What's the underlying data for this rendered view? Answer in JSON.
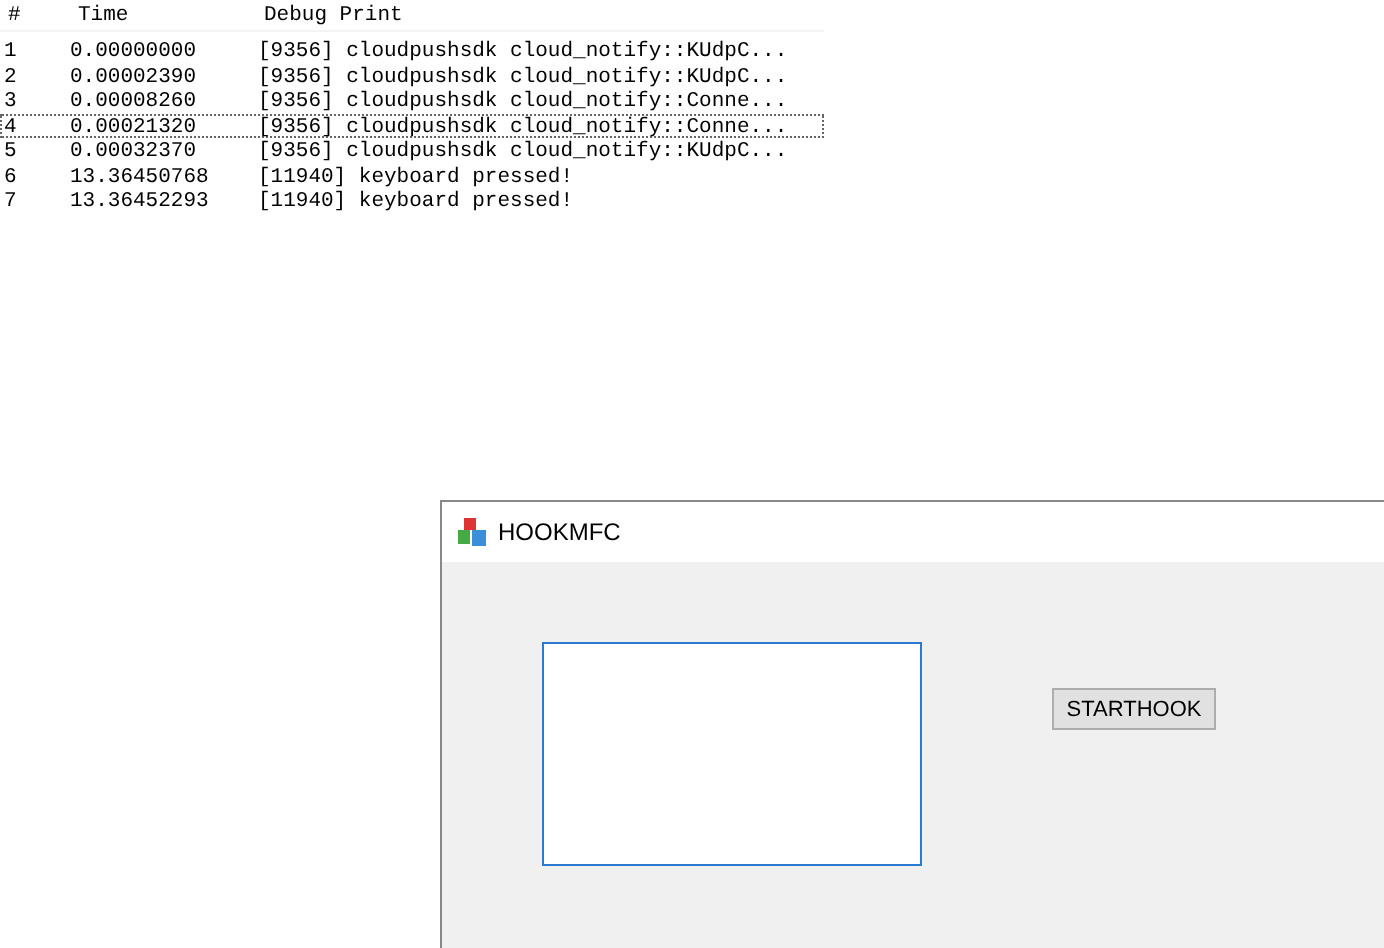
{
  "log": {
    "columns": [
      "#",
      "Time",
      "Debug Print"
    ],
    "rows": [
      {
        "index": "1",
        "time": "0.00000000",
        "text": "[9356] cloudpushsdk cloud_notify::KUdpC...",
        "focused": false
      },
      {
        "index": "2",
        "time": "0.00002390",
        "text": "[9356] cloudpushsdk cloud_notify::KUdpC...",
        "focused": false
      },
      {
        "index": "3",
        "time": "0.00008260",
        "text": "[9356] cloudpushsdk cloud_notify::Conne...",
        "focused": false
      },
      {
        "index": "4",
        "time": "0.00021320",
        "text": "[9356] cloudpushsdk cloud_notify::Conne...",
        "focused": true
      },
      {
        "index": "5",
        "time": "0.00032370",
        "text": "[9356] cloudpushsdk cloud_notify::KUdpC...",
        "focused": false
      },
      {
        "index": "6",
        "time": "13.36450768",
        "text": "[11940] keyboard pressed!",
        "focused": false
      },
      {
        "index": "7",
        "time": "13.36452293",
        "text": "[11940] keyboard pressed!",
        "focused": false
      }
    ]
  },
  "window": {
    "title": "HOOKMFC",
    "button": "STARTHOOK"
  }
}
